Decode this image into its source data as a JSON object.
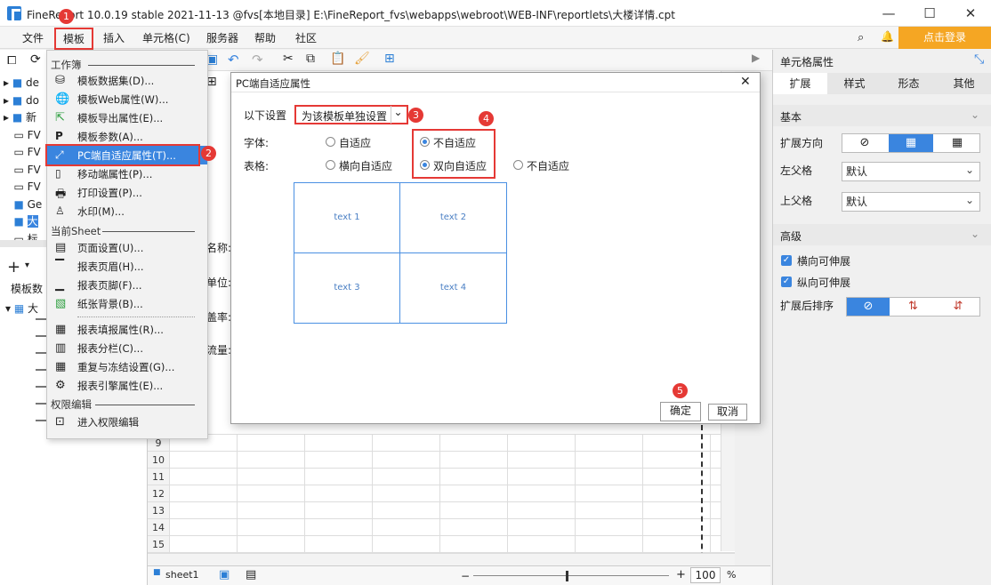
{
  "window": {
    "title": "FineReport 10.0.19 stable 2021-11-13 @fvs[本地目录]     E:\\FineReport_fvs\\webapps\\webroot\\WEB-INF\\reportlets\\大楼详情.cpt",
    "minimize": "—",
    "maximize": "☐",
    "close": "✕"
  },
  "menubar": {
    "items": [
      "文件",
      "模板",
      "插入",
      "单元格(C)",
      "服务器",
      "帮助",
      "社区"
    ],
    "login": "点击登录"
  },
  "dropdown": {
    "section_workbook": "工作簿",
    "workbook_items": [
      "模板数据集(D)...",
      "模板Web属性(W)...",
      "模板导出属性(E)...",
      "模板参数(A)...",
      "PC端自适应属性(T)...",
      "移动端属性(P)...",
      "打印设置(P)...",
      "水印(M)..."
    ],
    "section_sheet": "当前Sheet",
    "sheet_items": [
      "页面设置(U)...",
      "报表页眉(H)...",
      "报表页脚(F)...",
      "纸张背景(B)...",
      "报表填报属性(R)...",
      "报表分栏(C)...",
      "重复与冻结设置(G)...",
      "报表引擎属性(E)..."
    ],
    "section_perm": "权限编辑",
    "perm_items": [
      "进入权限编辑"
    ]
  },
  "dialog": {
    "title": "PC端自适应属性",
    "setting_label": "以下设置",
    "setting_value": "为该模板单独设置",
    "font_label": "字体:",
    "font_options": [
      "自适应",
      "不自适应"
    ],
    "table_label": "表格:",
    "table_options": [
      "横向自适应",
      "双向自适应",
      "不自适应"
    ],
    "preview_cells": [
      "text 1",
      "text 2",
      "text 3",
      "text 4"
    ],
    "ok": "确定",
    "cancel": "取消",
    "close": "✕"
  },
  "badges": [
    "1",
    "2",
    "3",
    "4",
    "5"
  ],
  "right_panel": {
    "title": "单元格属性",
    "tabs": [
      "扩展",
      "样式",
      "形态",
      "其他"
    ],
    "basic": "基本",
    "expand_dir_label": "扩展方向",
    "left_parent_label": "左父格",
    "left_parent_value": "默认",
    "up_parent_label": "上父格",
    "up_parent_value": "默认",
    "advanced": "高级",
    "h_expand": "横向可伸展",
    "v_expand": "纵向可伸展",
    "sort_label": "扩展后排序"
  },
  "left_tree": {
    "items": [
      "de",
      "do",
      "新",
      "FV",
      "FV",
      "FV",
      "FV",
      "Ge",
      "大",
      "标"
    ],
    "template_data_label": "模板数",
    "ds_root": "大"
  },
  "sheet": {
    "row_numbers": [
      "9",
      "10",
      "11",
      "12",
      "13",
      "14",
      "15"
    ],
    "partial_labels": [
      "名称:",
      "单位:",
      "盖率:",
      "流量:"
    ],
    "tab": "sheet1",
    "zoom": "100",
    "zoom_unit": "%"
  }
}
